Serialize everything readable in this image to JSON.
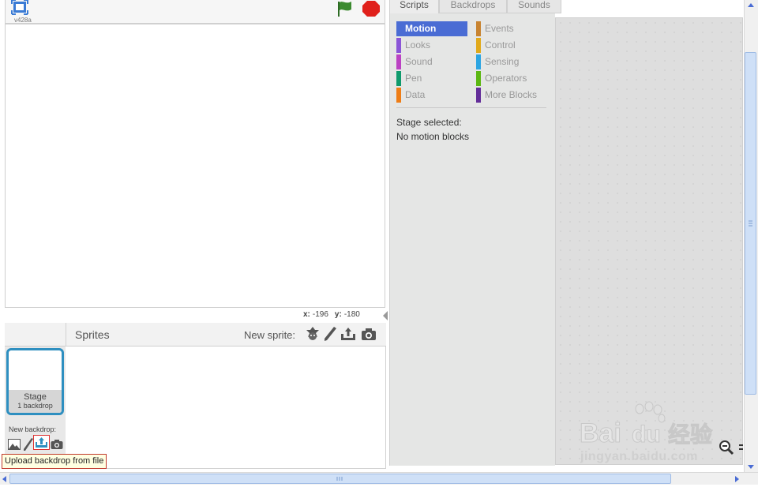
{
  "stage": {
    "version": "v428a",
    "coords": {
      "x_label": "x:",
      "x_value": "-196",
      "y_label": "y:",
      "y_value": "-180"
    }
  },
  "tabs": [
    {
      "label": "Scripts",
      "active": true
    },
    {
      "label": "Backdrops",
      "active": false
    },
    {
      "label": "Sounds",
      "active": false
    }
  ],
  "palette": {
    "categories_left": [
      {
        "label": "Motion",
        "color": "#4a6cd4",
        "selected": true
      },
      {
        "label": "Looks",
        "color": "#8a55d7"
      },
      {
        "label": "Sound",
        "color": "#bb42c3"
      },
      {
        "label": "Pen",
        "color": "#0e9a6c"
      },
      {
        "label": "Data",
        "color": "#ee7d16"
      }
    ],
    "categories_right": [
      {
        "label": "Events",
        "color": "#c88330"
      },
      {
        "label": "Control",
        "color": "#e1a91a"
      },
      {
        "label": "Sensing",
        "color": "#2ca5e2"
      },
      {
        "label": "Operators",
        "color": "#5cb712"
      },
      {
        "label": "More Blocks",
        "color": "#632d99"
      }
    ],
    "stage_selected": "Stage selected:",
    "no_blocks": "No motion blocks"
  },
  "sprites": {
    "title": "Sprites",
    "new_sprite_label": "New sprite:",
    "stage_thumb": {
      "name": "Stage",
      "count": "1 backdrop"
    },
    "new_backdrop_label": "New backdrop:",
    "tooltip": "Upload backdrop from file"
  },
  "watermark": {
    "logo_text_1": "Bai",
    "logo_text_2": "du",
    "logo_text_3": "经验",
    "url": "jingyan.baidu.com"
  },
  "colors": {
    "accent": "#4a6cd4",
    "stage_border": "#2e8fc0",
    "flag": "#3b8a2f",
    "stop": "#e0201b"
  }
}
